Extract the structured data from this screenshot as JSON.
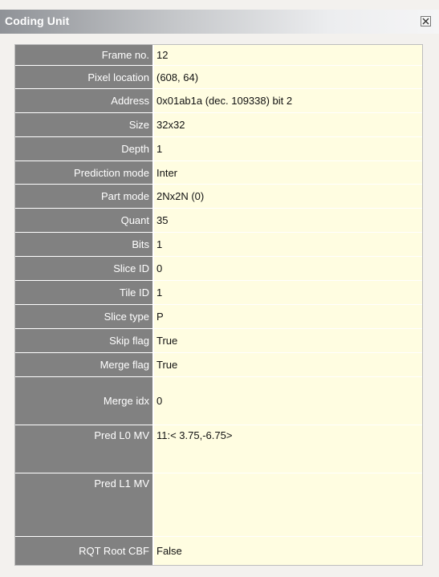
{
  "window": {
    "title": "Coding Unit"
  },
  "rows": [
    {
      "label": "Frame no.",
      "value": "12"
    },
    {
      "label": "Pixel location",
      "value": "(608, 64)"
    },
    {
      "label": "Address",
      "value": "0x01ab1a (dec. 109338) bit 2"
    },
    {
      "label": "Size",
      "value": "32x32"
    },
    {
      "label": "Depth",
      "value": "1"
    },
    {
      "label": "Prediction mode",
      "value": "Inter"
    },
    {
      "label": "Part mode",
      "value": "2Nx2N (0)"
    },
    {
      "label": "Quant",
      "value": "35"
    },
    {
      "label": "Bits",
      "value": "1"
    },
    {
      "label": "Slice ID",
      "value": "0"
    },
    {
      "label": "Tile ID",
      "value": "1"
    },
    {
      "label": "Slice type",
      "value": "P"
    },
    {
      "label": "Skip flag",
      "value": "True"
    },
    {
      "label": "Merge flag",
      "value": "True"
    },
    {
      "label": "Merge idx",
      "value": "0"
    },
    {
      "label": "Pred L0 MV",
      "value": "11:< 3.75,-6.75>"
    },
    {
      "label": "Pred L1 MV",
      "value": ""
    },
    {
      "label": "RQT Root CBF",
      "value": "False"
    }
  ]
}
